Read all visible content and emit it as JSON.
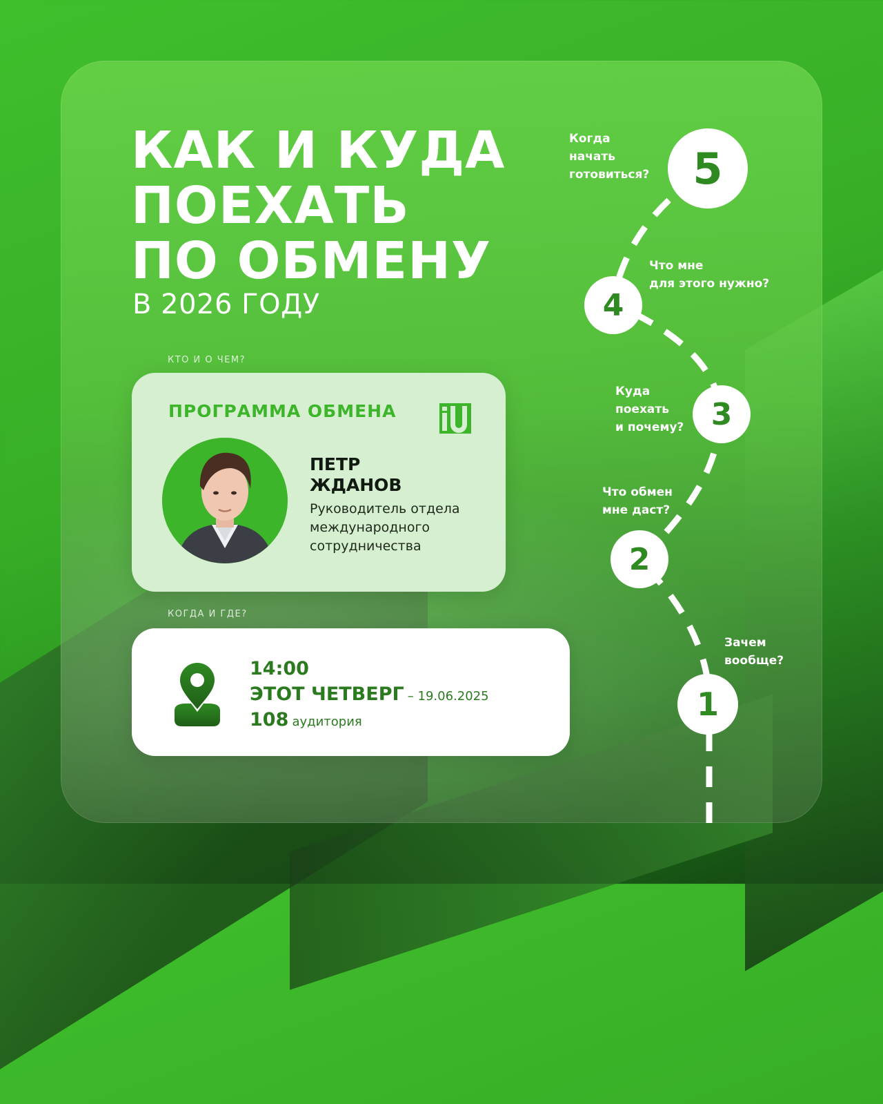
{
  "title": {
    "line1": "КАК И КУДА",
    "line2": "ПОЕХАТЬ",
    "line3": "ПО ОБМЕНУ",
    "subtitle": "В 2026 ГОДУ"
  },
  "who_label": "КТО И О ЧЕМ?",
  "speaker_card": {
    "heading": "ПРОГРАММА ОБМЕНА",
    "logo_text": "iU",
    "name_line1": "ПЕТР",
    "name_line2": "ЖДАНОВ",
    "role_line1": "Руководитель отдела",
    "role_line2": "международного",
    "role_line3": "сотрудничества"
  },
  "when_label": "КОГДА И ГДЕ?",
  "event_card": {
    "icon": "location-pin-icon",
    "time": "14:00",
    "day": "ЭТОТ ЧЕТВЕРГ",
    "date": "– 19.06.2025",
    "room_number": "108",
    "room_word": "аудитория"
  },
  "steps": [
    {
      "number": "1",
      "q1": "Зачем",
      "q2": "вообще?",
      "q3": ""
    },
    {
      "number": "2",
      "q1": "Что обмен",
      "q2": "мне даст?",
      "q3": ""
    },
    {
      "number": "3",
      "q1": "Куда",
      "q2": "поехать",
      "q3": "и почему?"
    },
    {
      "number": "4",
      "q1": "Что мне",
      "q2": "для этого нужно?",
      "q3": ""
    },
    {
      "number": "5",
      "q1": "Когда",
      "q2": "начать",
      "q3": "готовиться?"
    }
  ],
  "colors": {
    "brand_green": "#3db52a",
    "dark_green": "#2b7a1f",
    "card_bg": "#d5efd0",
    "white": "#ffffff"
  }
}
